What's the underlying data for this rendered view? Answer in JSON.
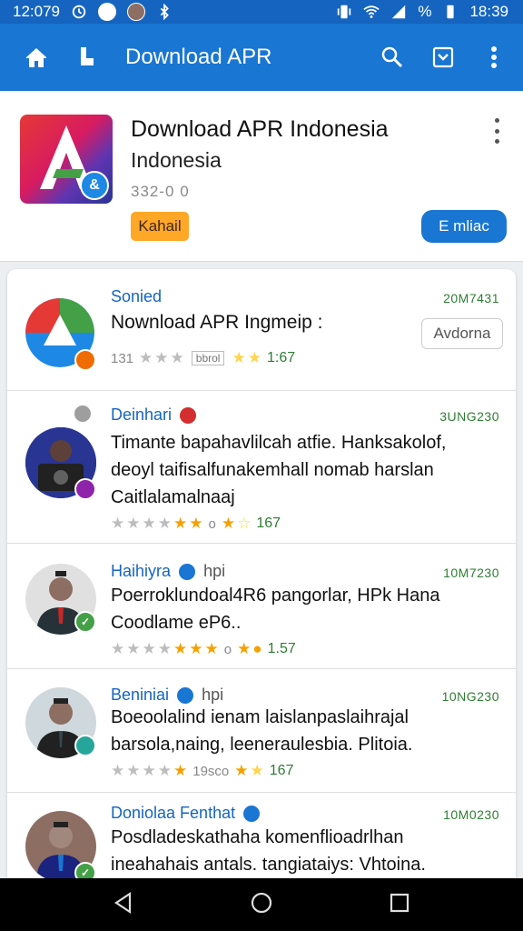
{
  "status_bar": {
    "time_left": "12:079",
    "time_right": "18:39",
    "battery_text": "%"
  },
  "app_bar": {
    "title": "Download APR"
  },
  "header": {
    "title": "Download APR Indonesia",
    "subtitle": "Indonesia",
    "meta": "332-0 0",
    "tag_label": "Kahail",
    "install_label": "E mliac"
  },
  "reviews": [
    {
      "name": "Sonied",
      "date": "20M7431",
      "text": "Nownload APR Ingmeip :",
      "rating_prefix": "131",
      "boxed_label": "bbrol",
      "rating_count": "1:67",
      "side_button": "Avdorna"
    },
    {
      "name": "Deinhari",
      "date": "3UNG230",
      "text": "Timante bapahavlilcah atfie. Hanksakolof, deoyl taifisalfunakemhall nomab harslan Caitlalamalnaaj",
      "rating_mid": "o",
      "rating_count": "167"
    },
    {
      "name": "Haihiyra",
      "name_suffix": "hpi",
      "date": "10M7230",
      "text": "Poerroklundoal4R6 pangorlar, HPk Hana Coodlame eP6..",
      "rating_mid": "o",
      "rating_count": "1.57"
    },
    {
      "name": "Beniniai",
      "name_suffix": "hpi",
      "date": "10NG230",
      "text": "Boeoolalind ienam laislanpaslaihrajal barsola,naing, leeneraulesbia. Plitoia.",
      "rating_mid": "19sco",
      "rating_count": "167"
    },
    {
      "name": "Doniolaa Fenthat",
      "date": "10M0230",
      "text": "Posdladeskathaha komenflioadrlhan ineahahais antals. tangiataiys: Vhtoina."
    }
  ]
}
